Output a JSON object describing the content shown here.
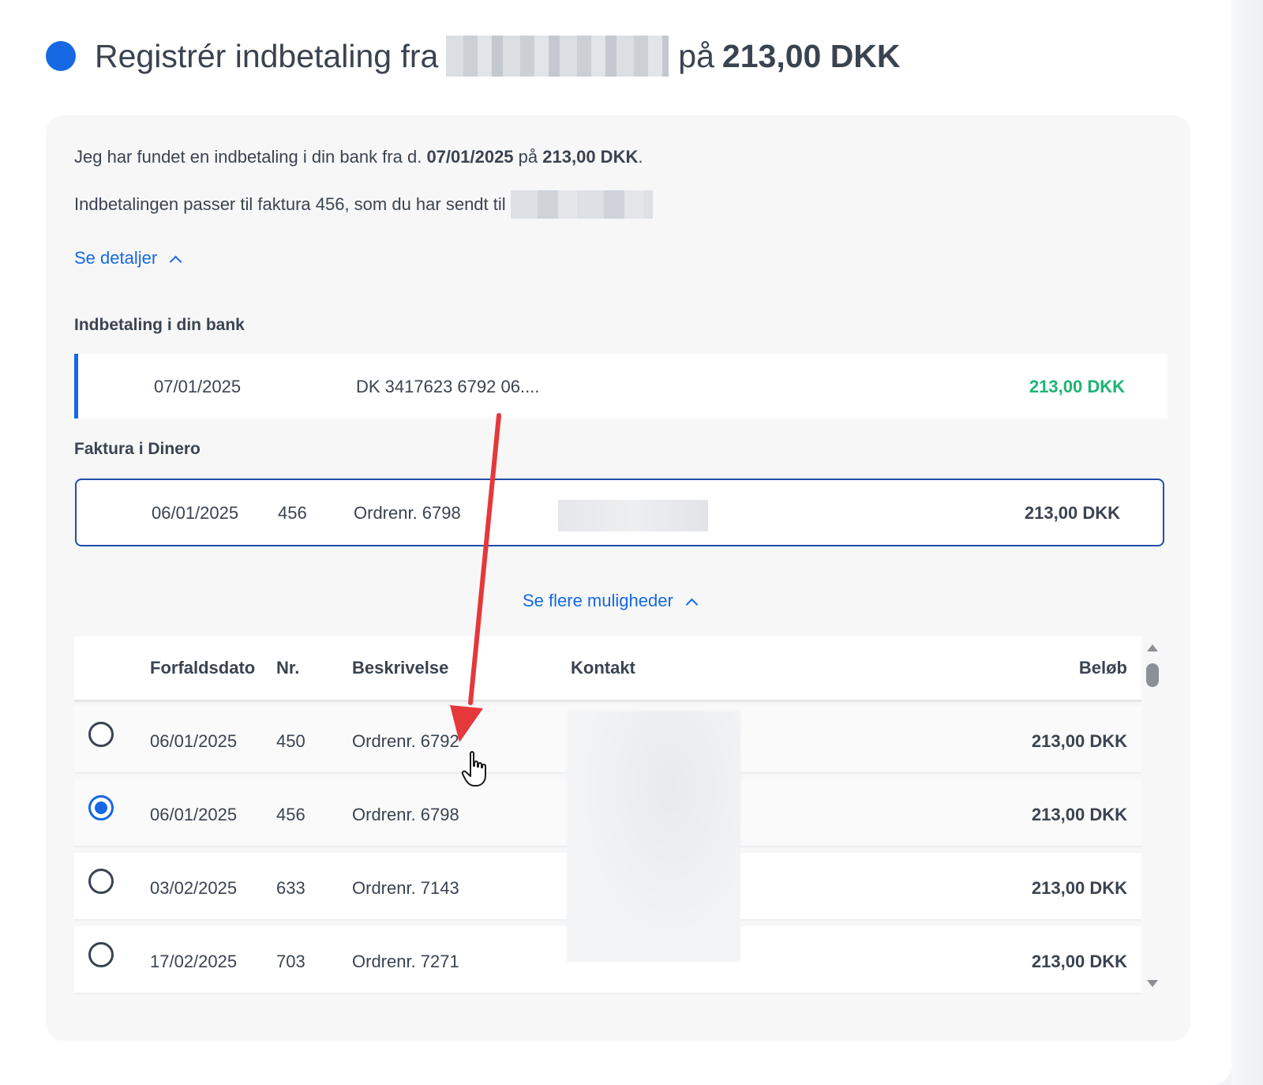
{
  "header": {
    "title_prefix": "Registrér indbetaling fra",
    "title_middle": "på",
    "title_amount": "213,00 DKK",
    "status_color": "#1668e3"
  },
  "intro": {
    "line1_prefix": "Jeg har fundet en indbetaling i din bank fra d.",
    "line1_date": "07/01/2025",
    "line1_mid": "på",
    "line1_amount": "213,00 DKK",
    "line1_end": ".",
    "line2": "Indbetalingen passer til faktura 456, som du har sendt til"
  },
  "links": {
    "see_details": "Se detaljer",
    "see_more": "Se flere muligheder"
  },
  "bank_section": {
    "label": "Indbetaling i din bank",
    "date": "07/01/2025",
    "account": "DK 3417623 6792 06....",
    "amount": "213,00 DKK"
  },
  "invoice_section": {
    "label": "Faktura i Dinero",
    "date": "06/01/2025",
    "nr": "456",
    "description": "Ordrenr. 6798",
    "amount": "213,00 DKK"
  },
  "table": {
    "headers": {
      "date": "Forfaldsdato",
      "nr": "Nr.",
      "description": "Beskrivelse",
      "contact": "Kontakt",
      "amount": "Beløb"
    },
    "rows": [
      {
        "date": "06/01/2025",
        "nr": "450",
        "description": "Ordrenr. 6792",
        "amount": "213,00 DKK"
      },
      {
        "date": "06/01/2025",
        "nr": "456",
        "description": "Ordrenr. 6798",
        "amount": "213,00 DKK"
      },
      {
        "date": "03/02/2025",
        "nr": "633",
        "description": "Ordrenr. 7143",
        "amount": "213,00 DKK"
      },
      {
        "date": "17/02/2025",
        "nr": "703",
        "description": "Ordrenr. 7271",
        "amount": "213,00 DKK"
      }
    ]
  },
  "colors": {
    "accent": "#1668e3",
    "positive_amount": "#1bb574",
    "annotation_arrow": "#e5383b"
  }
}
